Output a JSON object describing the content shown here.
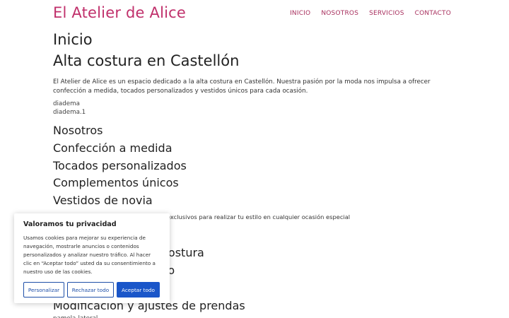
{
  "site": {
    "title": "El Atelier de Alice"
  },
  "nav": {
    "items": [
      "INICIO",
      "NOSOTROS",
      "SERVICIOS",
      "CONTACTO"
    ]
  },
  "main": {
    "page_title": "Inicio",
    "heading": "Alta costura en Castellón",
    "intro": "El Atelier de Alice es un espacio dedicado a la alta costura en Castellón. Nuestra pasión por la moda nos impulsa a ofrecer confección a medida, tocados personalizados y vestidos únicos para cada ocasión.",
    "images": [
      "diadema",
      "diadema.1"
    ],
    "about_heading": "Nosotros",
    "about_items": [
      "Confección a medida",
      "Tocados personalizados",
      "Complementos únicos",
      "Vestidos de novia"
    ],
    "tagline": "En El Atelier de Alice creamos diseños exclusivos para realizar tu estilo en cualquier ocasión especial",
    "services": [
      "Confección de alta costura",
      "Tocado personalizado",
      "Vestidos a medida",
      "Modificación y ajustes de prendas"
    ],
    "bottom_image": "pamela-lateral"
  },
  "cookie": {
    "title": "Valoramos tu privacidad",
    "text": "Usamos cookies para mejorar su experiencia de navegación, mostrarle anuncios o contenidos personalizados y analizar nuestro tráfico. Al hacer clic en “Aceptar todo” usted da su consentimiento a nuestro uso de las cookies.",
    "buttons": {
      "customize": "Personalizar",
      "reject": "Rechazar todo",
      "accept": "Aceptar todo"
    }
  },
  "colors": {
    "brand": "#c0306b",
    "nav": "#a8305e",
    "primary_button": "#1a56c9"
  }
}
